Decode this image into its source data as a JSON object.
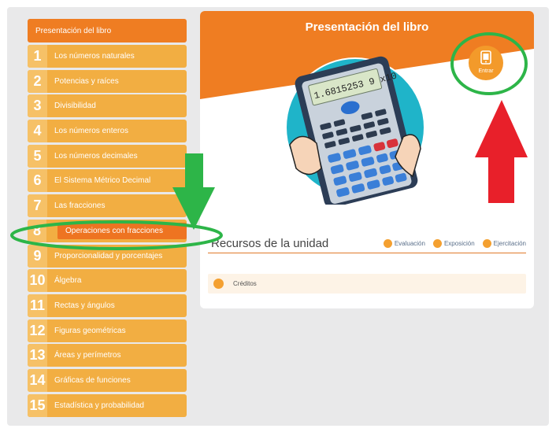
{
  "sidebar": {
    "header": "Presentación del libro",
    "items": [
      {
        "num": "1",
        "label": "Los números naturales"
      },
      {
        "num": "2",
        "label": "Potencias y raíces"
      },
      {
        "num": "3",
        "label": "Divisibilidad"
      },
      {
        "num": "4",
        "label": "Los números enteros"
      },
      {
        "num": "5",
        "label": "Los números decimales"
      },
      {
        "num": "6",
        "label": "El Sistema Métrico Decimal"
      },
      {
        "num": "7",
        "label": "Las fracciones"
      },
      {
        "num": "8",
        "label": "Operaciones con fracciones"
      },
      {
        "num": "9",
        "label": "Proporcionalidad y porcentajes"
      },
      {
        "num": "10",
        "label": "Álgebra"
      },
      {
        "num": "11",
        "label": "Rectas y ángulos"
      },
      {
        "num": "12",
        "label": "Figuras geométricas"
      },
      {
        "num": "13",
        "label": "Áreas y perímetros"
      },
      {
        "num": "14",
        "label": "Gráficas de funciones"
      },
      {
        "num": "15",
        "label": "Estadística y probabilidad"
      }
    ],
    "active_index": 7
  },
  "main": {
    "title": "Presentación del libro",
    "enter_label": "Entrar",
    "calculator_display": "1.6815253 9 x10",
    "resources_title": "Recursos de la unidad",
    "resource_links": [
      "Evaluación",
      "Exposición",
      "Ejercitación"
    ],
    "credits_label": "Créditos"
  },
  "colors": {
    "accent": "#ef7d22",
    "sidebar_item": "#f2ae42",
    "annotation_green": "#2db548",
    "annotation_red": "#e8202a"
  },
  "icons": [
    "tablet-icon",
    "evaluation-icon",
    "exposition-icon",
    "exercise-icon",
    "credits-icon"
  ]
}
